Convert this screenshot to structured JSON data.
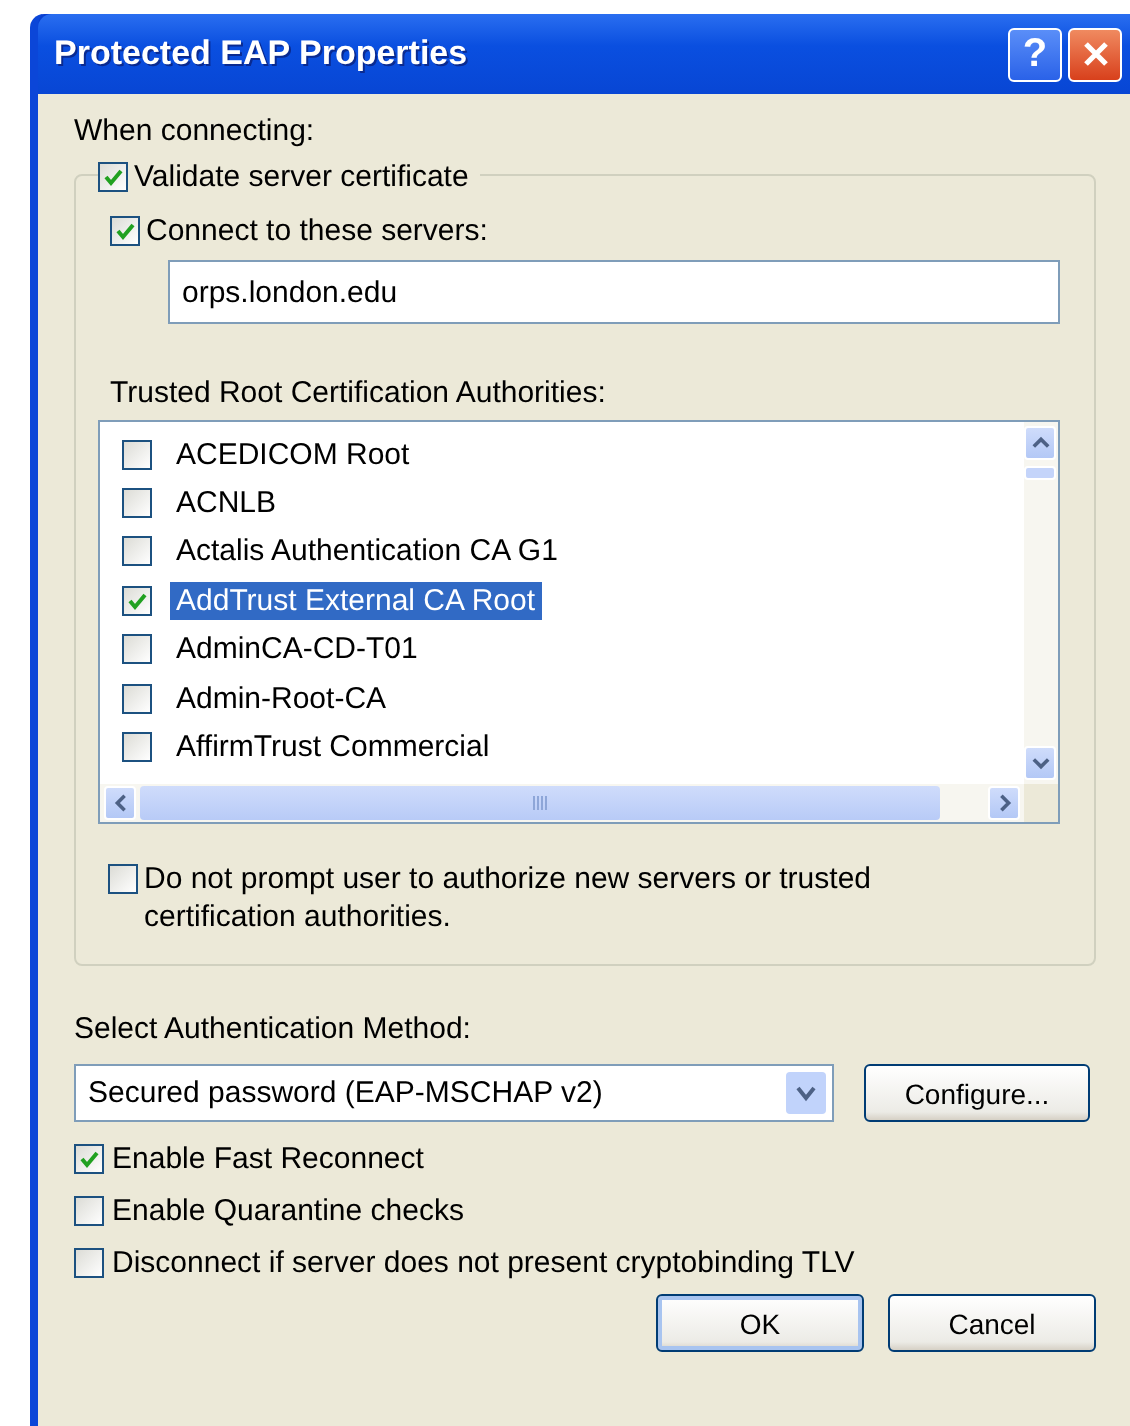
{
  "window": {
    "title": "Protected EAP Properties",
    "help_button": "?"
  },
  "when_connecting_label": "When connecting:",
  "validate_server_certificate": {
    "label": "Validate server certificate",
    "checked": true
  },
  "connect_to_servers": {
    "label": "Connect to these servers:",
    "checked": true,
    "value": "orps.london.edu"
  },
  "trusted_root_label": "Trusted Root Certification Authorities:",
  "certificates": [
    {
      "name": "ACEDICOM Root",
      "checked": false,
      "selected": false
    },
    {
      "name": "ACNLB",
      "checked": false,
      "selected": false
    },
    {
      "name": "Actalis Authentication CA G1",
      "checked": false,
      "selected": false
    },
    {
      "name": "AddTrust External CA Root",
      "checked": true,
      "selected": true
    },
    {
      "name": "AdminCA-CD-T01",
      "checked": false,
      "selected": false
    },
    {
      "name": "Admin-Root-CA",
      "checked": false,
      "selected": false
    },
    {
      "name": "AffirmTrust Commercial",
      "checked": false,
      "selected": false
    }
  ],
  "do_not_prompt": {
    "label": "Do not prompt user to authorize new servers or trusted certification authorities.",
    "checked": false
  },
  "auth_method_label": "Select Authentication Method:",
  "auth_method": {
    "value": "Secured password (EAP-MSCHAP v2)"
  },
  "configure_button": "Configure...",
  "options": [
    {
      "label": "Enable Fast Reconnect",
      "checked": true
    },
    {
      "label": "Enable Quarantine checks",
      "checked": false
    },
    {
      "label": "Disconnect if server does not present cryptobinding TLV",
      "checked": false
    }
  ],
  "buttons": [
    {
      "label": "OK",
      "kind": "default"
    },
    {
      "label": "Cancel",
      "kind": "normal"
    }
  ]
}
